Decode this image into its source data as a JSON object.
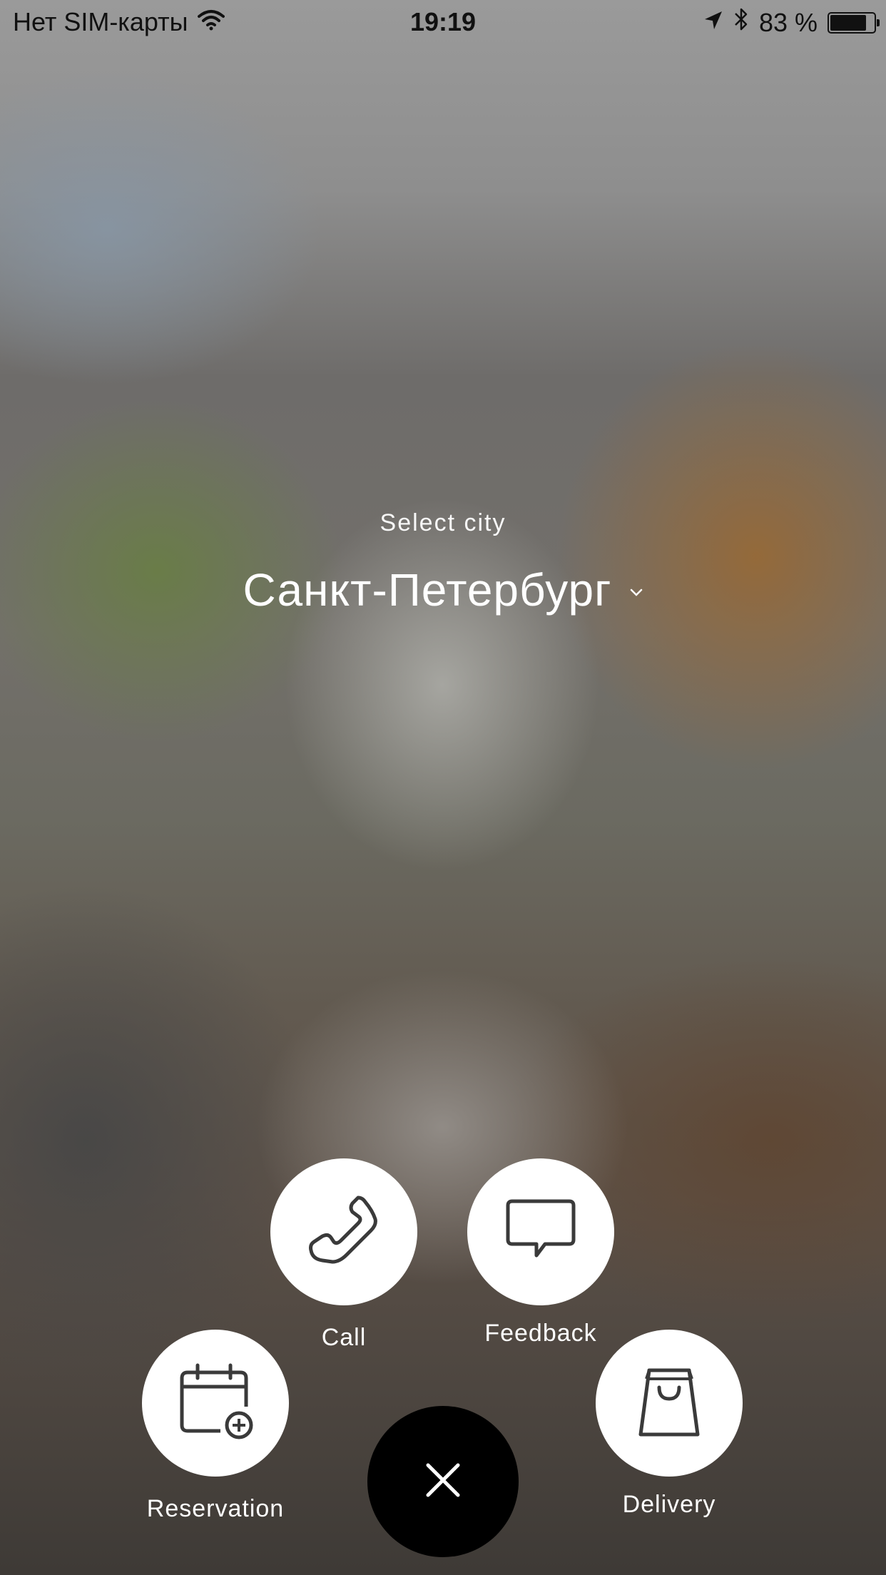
{
  "status_bar": {
    "carrier": "Нет SIM-карты",
    "time": "19:19",
    "battery_percent": "83 %",
    "battery_level": 0.83
  },
  "city": {
    "label": "Select city",
    "selected": "Санкт-Петербург"
  },
  "actions": {
    "call": {
      "label": "Call",
      "icon": "phone-icon"
    },
    "feedback": {
      "label": "Feedback",
      "icon": "chat-bubble-icon"
    },
    "reservation": {
      "label": "Reservation",
      "icon": "calendar-add-icon"
    },
    "delivery": {
      "label": "Delivery",
      "icon": "shopping-bag-icon"
    },
    "close": {
      "icon": "close-icon"
    }
  },
  "colors": {
    "button_background": "#ffffff",
    "icon_stroke": "#3a3a3a",
    "close_background": "#000000",
    "label_text": "#ffffff"
  }
}
